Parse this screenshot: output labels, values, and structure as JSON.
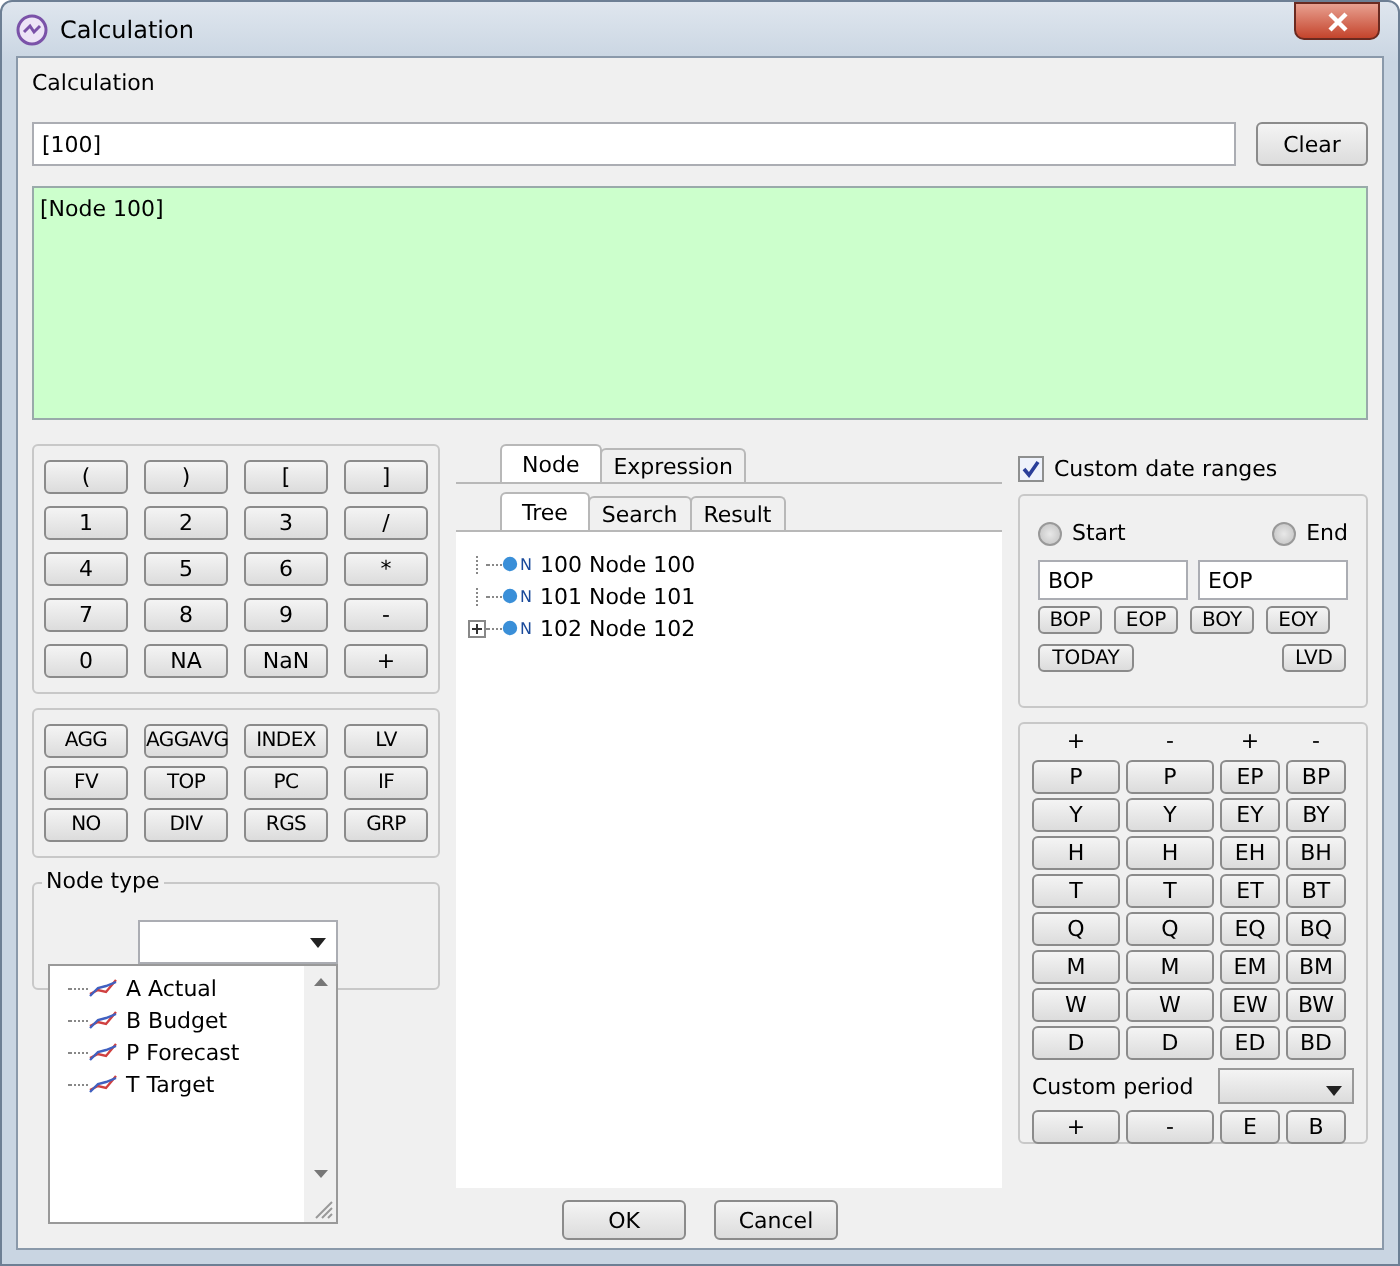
{
  "window": {
    "title": "Calculation"
  },
  "calculation": {
    "label": "Calculation",
    "value": "[100]",
    "clear": "Clear",
    "result": "[Node 100]"
  },
  "keypad": [
    "(",
    ")",
    "[",
    "]",
    "1",
    "2",
    "3",
    "/",
    "4",
    "5",
    "6",
    "*",
    "7",
    "8",
    "9",
    "-",
    "0",
    "NA",
    "NaN",
    "+"
  ],
  "functions": [
    "AGG",
    "AGGAVG",
    "INDEX",
    "LV",
    "FV",
    "TOP",
    "PC",
    "IF",
    "NO",
    "DIV",
    "RGS",
    "GRP"
  ],
  "node_type": {
    "label": "Node type",
    "items": [
      "A Actual",
      "B Budget",
      "P Forecast",
      "T Target"
    ]
  },
  "outer_tabs": [
    {
      "label": "Node",
      "selected": true
    },
    {
      "label": "Expression",
      "selected": false
    }
  ],
  "inner_tabs": [
    {
      "label": "Tree",
      "selected": true
    },
    {
      "label": "Search",
      "selected": false
    },
    {
      "label": "Result",
      "selected": false
    }
  ],
  "tree": [
    {
      "badge": "N",
      "label": "100 Node 100",
      "expandable": false
    },
    {
      "badge": "N",
      "label": "101 Node 101",
      "expandable": false
    },
    {
      "badge": "N",
      "label": "102 Node 102",
      "expandable": true
    }
  ],
  "custom_dates": {
    "label": "Custom date ranges",
    "checked": true,
    "start": {
      "label": "Start",
      "selected": false,
      "value": "BOP"
    },
    "end": {
      "label": "End",
      "selected": false,
      "value": "EOP"
    },
    "buttons": [
      "BOP",
      "EOP",
      "BOY",
      "EOY",
      "TODAY",
      "LVD"
    ]
  },
  "period": {
    "headers": [
      "+",
      "-",
      "+",
      "-"
    ],
    "rows": [
      [
        "P",
        "P",
        "EP",
        "BP"
      ],
      [
        "Y",
        "Y",
        "EY",
        "BY"
      ],
      [
        "H",
        "H",
        "EH",
        "BH"
      ],
      [
        "T",
        "T",
        "ET",
        "BT"
      ],
      [
        "Q",
        "Q",
        "EQ",
        "BQ"
      ],
      [
        "M",
        "M",
        "EM",
        "BM"
      ],
      [
        "W",
        "W",
        "EW",
        "BW"
      ],
      [
        "D",
        "D",
        "ED",
        "BD"
      ]
    ],
    "custom_label": "Custom period",
    "bottom": [
      "+",
      "-",
      "E",
      "B"
    ]
  },
  "buttons": [
    "OK",
    "Cancel"
  ]
}
